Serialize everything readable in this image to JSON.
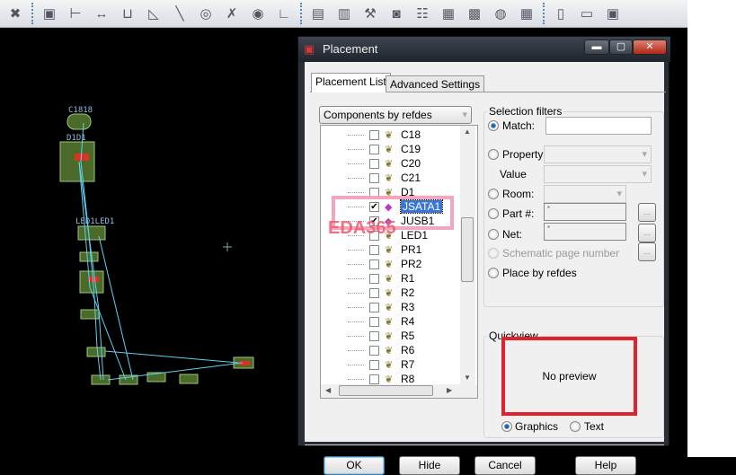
{
  "toolbar": {
    "icons": [
      "delete-icon",
      "component-icon",
      "dimension-icon",
      "dimension-linear-icon",
      "dimension-datum-icon",
      "angle-icon",
      "line-icon",
      "circle-icon",
      "arc-icon",
      "text-icon",
      "corner-icon",
      "odb-icon",
      "library-icon",
      "tools-icon",
      "camera-icon",
      "refdes-icon",
      "report-icon",
      "grid-icon",
      "testpoint-icon",
      "array-icon",
      "note-icon",
      "book-icon",
      "package-icon"
    ]
  },
  "pcb": {
    "labels": [
      "C1818",
      "D1D1",
      "LED1LED1"
    ]
  },
  "dialog": {
    "title": "Placement",
    "tabs": [
      {
        "label": "Placement List",
        "active": true
      },
      {
        "label": "Advanced Settings",
        "active": false
      }
    ],
    "list_mode": "Components by refdes",
    "tree_items": [
      {
        "label": "C18",
        "checked": false,
        "icon": "component"
      },
      {
        "label": "C19",
        "checked": false,
        "icon": "component"
      },
      {
        "label": "C20",
        "checked": false,
        "icon": "component"
      },
      {
        "label": "C21",
        "checked": false,
        "icon": "component"
      },
      {
        "label": "D1",
        "checked": false,
        "icon": "component"
      },
      {
        "label": "JSATA1",
        "checked": true,
        "icon": "placed",
        "selected": true
      },
      {
        "label": "JUSB1",
        "checked": true,
        "icon": "placed"
      },
      {
        "label": "LED1",
        "checked": false,
        "icon": "component"
      },
      {
        "label": "PR1",
        "checked": false,
        "icon": "component"
      },
      {
        "label": "PR2",
        "checked": false,
        "icon": "component"
      },
      {
        "label": "R1",
        "checked": false,
        "icon": "component"
      },
      {
        "label": "R2",
        "checked": false,
        "icon": "component"
      },
      {
        "label": "R3",
        "checked": false,
        "icon": "component"
      },
      {
        "label": "R4",
        "checked": false,
        "icon": "component"
      },
      {
        "label": "R5",
        "checked": false,
        "icon": "component"
      },
      {
        "label": "R6",
        "checked": false,
        "icon": "component"
      },
      {
        "label": "R7",
        "checked": false,
        "icon": "component"
      },
      {
        "label": "R8",
        "checked": false,
        "icon": "component"
      }
    ],
    "watermark": "EDA365",
    "filters": {
      "title": "Selection filters",
      "match_label": "Match:",
      "match_value": "",
      "property_label": "Property:",
      "value_label": "Value",
      "room_label": "Room:",
      "part_label": "Part #:",
      "part_value": "*",
      "net_label": "Net:",
      "net_value": "*",
      "schematic_label": "Schematic page number",
      "refdes_label": "Place by refdes",
      "browse": "...",
      "selected": "match"
    },
    "quickview": {
      "title": "Quickview",
      "preview_text": "No preview",
      "graphics_label": "Graphics",
      "text_label": "Text",
      "selected": "graphics"
    },
    "buttons": {
      "ok": "OK",
      "hide": "Hide",
      "cancel": "Cancel",
      "help": "Help"
    },
    "colors": {
      "highlight_box": "#f4a6bd",
      "preview_box": "#e0232b",
      "selection": "#3875d7"
    }
  }
}
